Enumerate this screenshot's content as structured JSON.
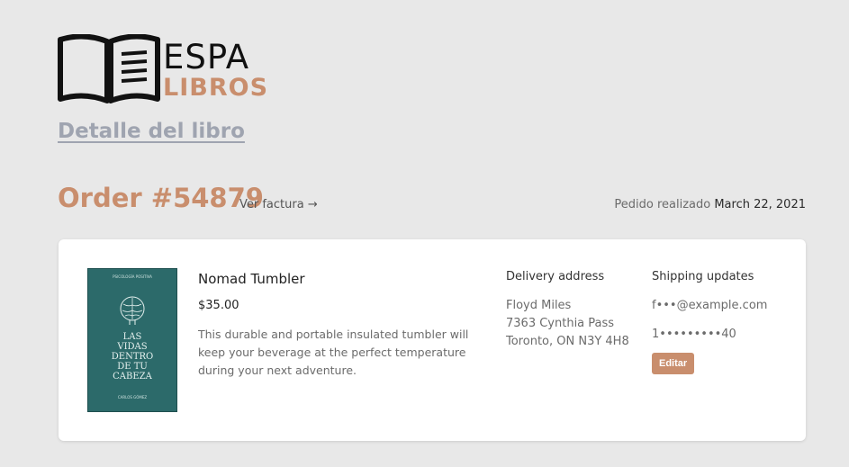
{
  "brand": {
    "line1": "ESPA",
    "line2": "LIBROS",
    "accent_color": "#c98e6d",
    "logo_icon": "open-book-icon"
  },
  "header": {
    "subtitle": "Detalle del libro"
  },
  "order": {
    "title": "Order #54879",
    "invoice_link": "Ver factura →",
    "placed_label": "Pedido realizado",
    "placed_date": "March 22, 2021"
  },
  "product": {
    "name": "Nomad Tumbler",
    "price": "$35.00",
    "description": "This durable and portable insulated tumbler will keep your beverage at the perfect temperature during your next adventure.",
    "cover": {
      "top_text": "PSICOLOGÍA POSITIVA",
      "title": [
        "LAS",
        "VIDAS",
        "DENTRO",
        "DE TU",
        "CABEZA"
      ],
      "author": "CARLOS GÓMEZ",
      "bg_color": "#2c6a6a"
    }
  },
  "delivery": {
    "heading": "Delivery address",
    "lines": [
      "Floyd Miles",
      "7363 Cynthia Pass",
      "Toronto, ON N3Y 4H8"
    ]
  },
  "shipping": {
    "heading": "Shipping updates",
    "email": "f•••@example.com",
    "phone": "1•••••••••40",
    "edit_label": "Editar"
  }
}
